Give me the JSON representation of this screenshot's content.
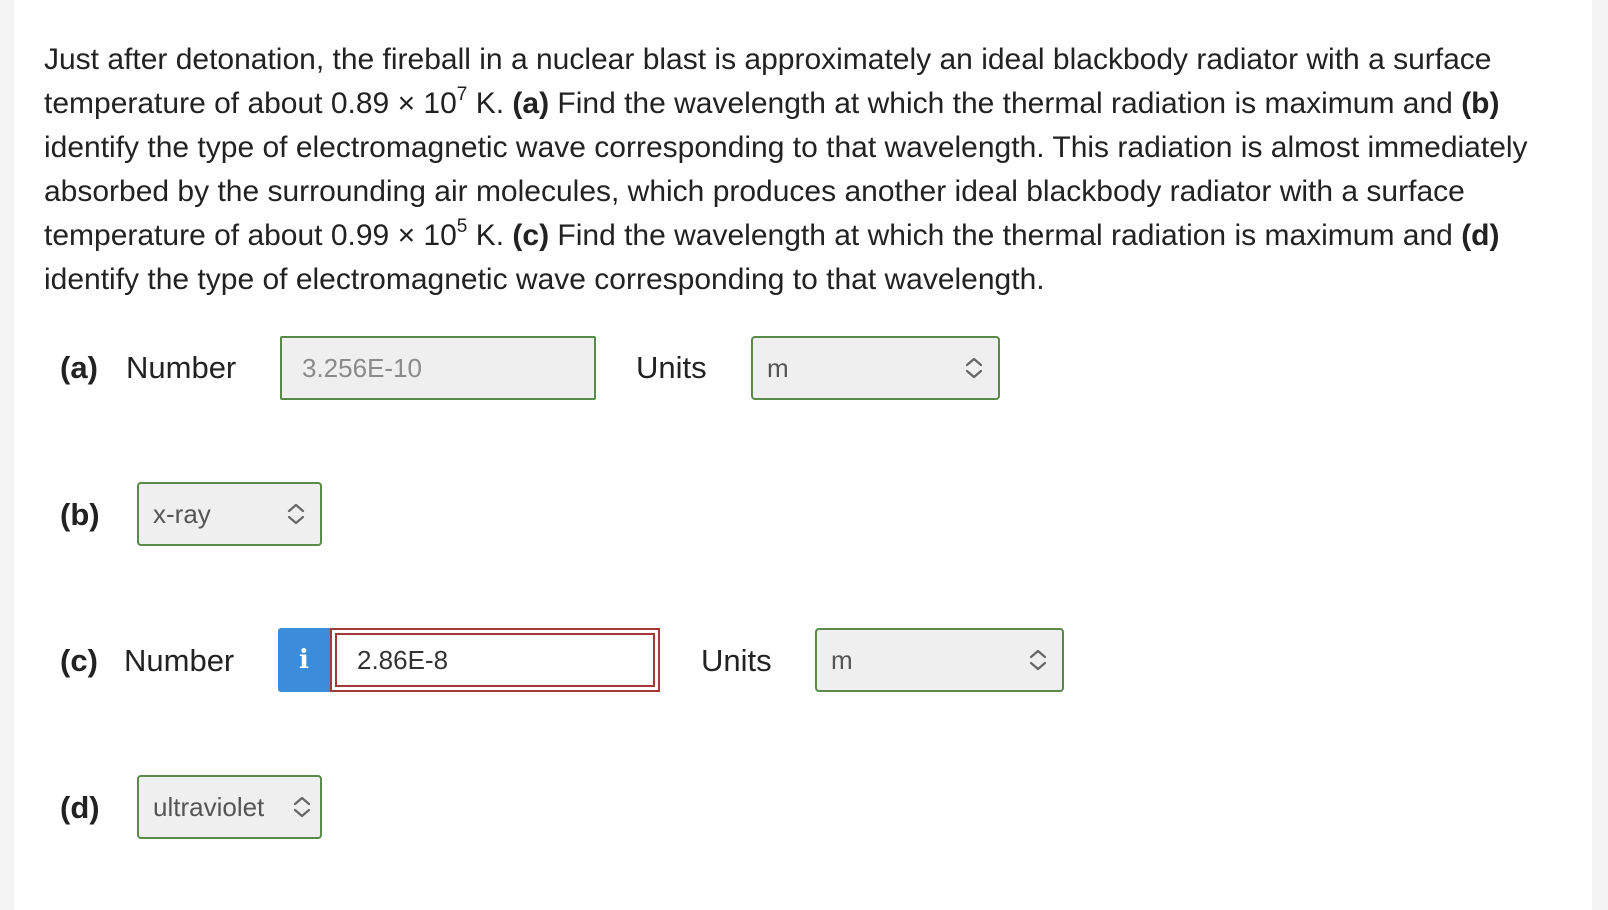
{
  "question": {
    "p1": "Just after detonation, the fireball in a nuclear blast is approximately an ideal blackbody radiator with a surface temperature of about 0.89 × 10",
    "exp1": "7",
    "p2": " K. ",
    "tag_a": "(a)",
    "p3": " Find the wavelength at which the thermal radiation is maximum and ",
    "tag_b": "(b)",
    "p4": " identify the type of electromagnetic wave corresponding to that wavelength. This radiation is almost immediately absorbed by the surrounding air molecules, which produces another ideal blackbody radiator with a surface temperature of about 0.99 × 10",
    "exp2": "5",
    "p5": " K. ",
    "tag_c": "(c)",
    "p6": " Find the wavelength at which the thermal radiation is maximum and ",
    "tag_d": "(d)",
    "p7": " identify the type of electromagnetic wave corresponding to that wavelength."
  },
  "part_a": {
    "tag": "(a)",
    "number_label": "Number",
    "number_value": "3.256E-10",
    "units_label": "Units",
    "units_value": "m"
  },
  "part_b": {
    "tag": "(b)",
    "value": "x-ray"
  },
  "part_c": {
    "tag": "(c)",
    "number_label": "Number",
    "info_icon": "i",
    "number_value": "2.86E-8",
    "units_label": "Units",
    "units_value": "m"
  },
  "part_d": {
    "tag": "(d)",
    "value": "ultraviolet"
  },
  "colors": {
    "correct_border": "#5a8a4a",
    "error_border": "#a33a3a",
    "info_blue": "#3b8cdb"
  },
  "icons": {
    "select_arrows": "updown-chevron-icon",
    "info": "info-icon"
  }
}
